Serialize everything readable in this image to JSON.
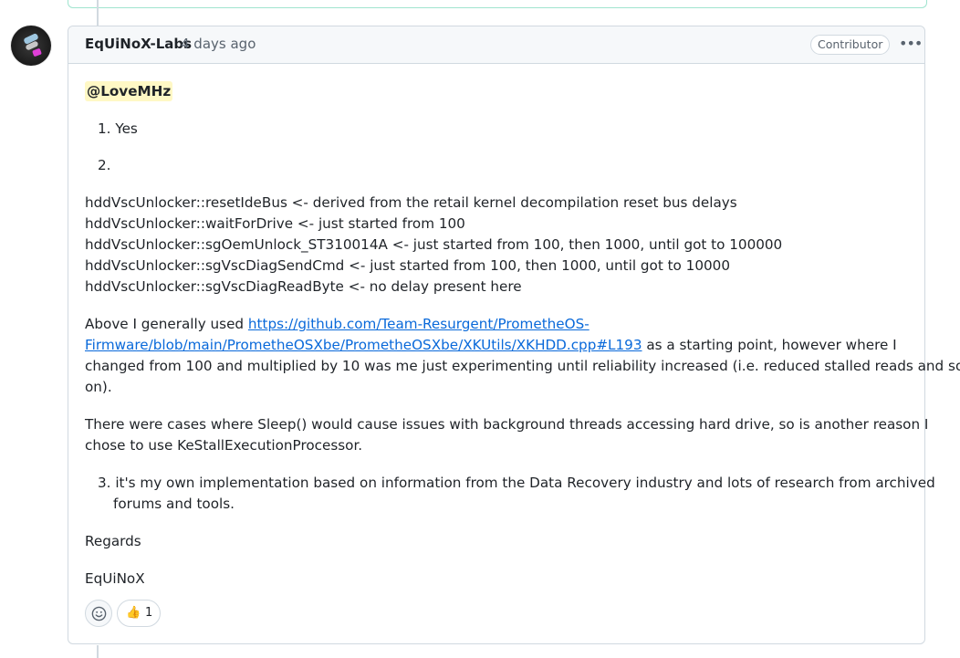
{
  "comment": {
    "author": "EqUiNoX-Labs",
    "timestamp": "4 days ago",
    "badge": "Contributor",
    "menu_icon": "kebab-horizontal-icon",
    "mention": "@LoveMHz",
    "list_top": [
      {
        "num": "1.",
        "text": "Yes"
      },
      {
        "num": "2.",
        "text": ""
      }
    ],
    "code_lines": [
      "hddVscUnlocker::resetIdeBus <- derived from the retail kernel decompilation reset bus delays",
      "hddVscUnlocker::waitForDrive <- just started from 100",
      "hddVscUnlocker::sgOemUnlock_ST310014A <- just started from 100, then 1000, until got to 100000",
      "hddVscUnlocker::sgVscDiagSendCmd <- just started from 100, then 1000, until got to 10000",
      "hddVscUnlocker::sgVscDiagReadByte <- no delay present here"
    ],
    "para1_prefix": "Above I generally used ",
    "para1_link_line1": "https://github.com/Team-Resurgent/PrometheOS-",
    "para1_link_line2": "Firmware/blob/main/PrometheOSXbe/PrometheOSXbe/XKUtils/XKHDD.cpp#L193",
    "para1_suffix_line2": " as a starting point, however where I",
    "para1_line3": "changed from 100 and multiplied by 10 was me just experimenting until reliability increased (i.e. reduced stalled reads and so",
    "para1_line4": "on).",
    "para2_line1": "There were cases where Sleep() would cause issues with background threads accessing hard drive, so is another reason I",
    "para2_line2": "chose to use KeStallExecutionProcessor.",
    "list3_num": "3.",
    "list3_line1": "it's my own implementation based on information from the Data Recovery industry and lots of research from archived",
    "list3_line2": "forums and tools.",
    "regards": "Regards",
    "signature": "EqUiNoX"
  },
  "reactions": {
    "add_icon": "smiley-icon",
    "thumbs_up_emoji": "👍",
    "thumbs_up_count": "1"
  },
  "colors": {
    "link": "#0969da",
    "mention_bg": "#fff8c5",
    "border": "#d1d9e0",
    "header_bg": "#f6f8fa"
  }
}
